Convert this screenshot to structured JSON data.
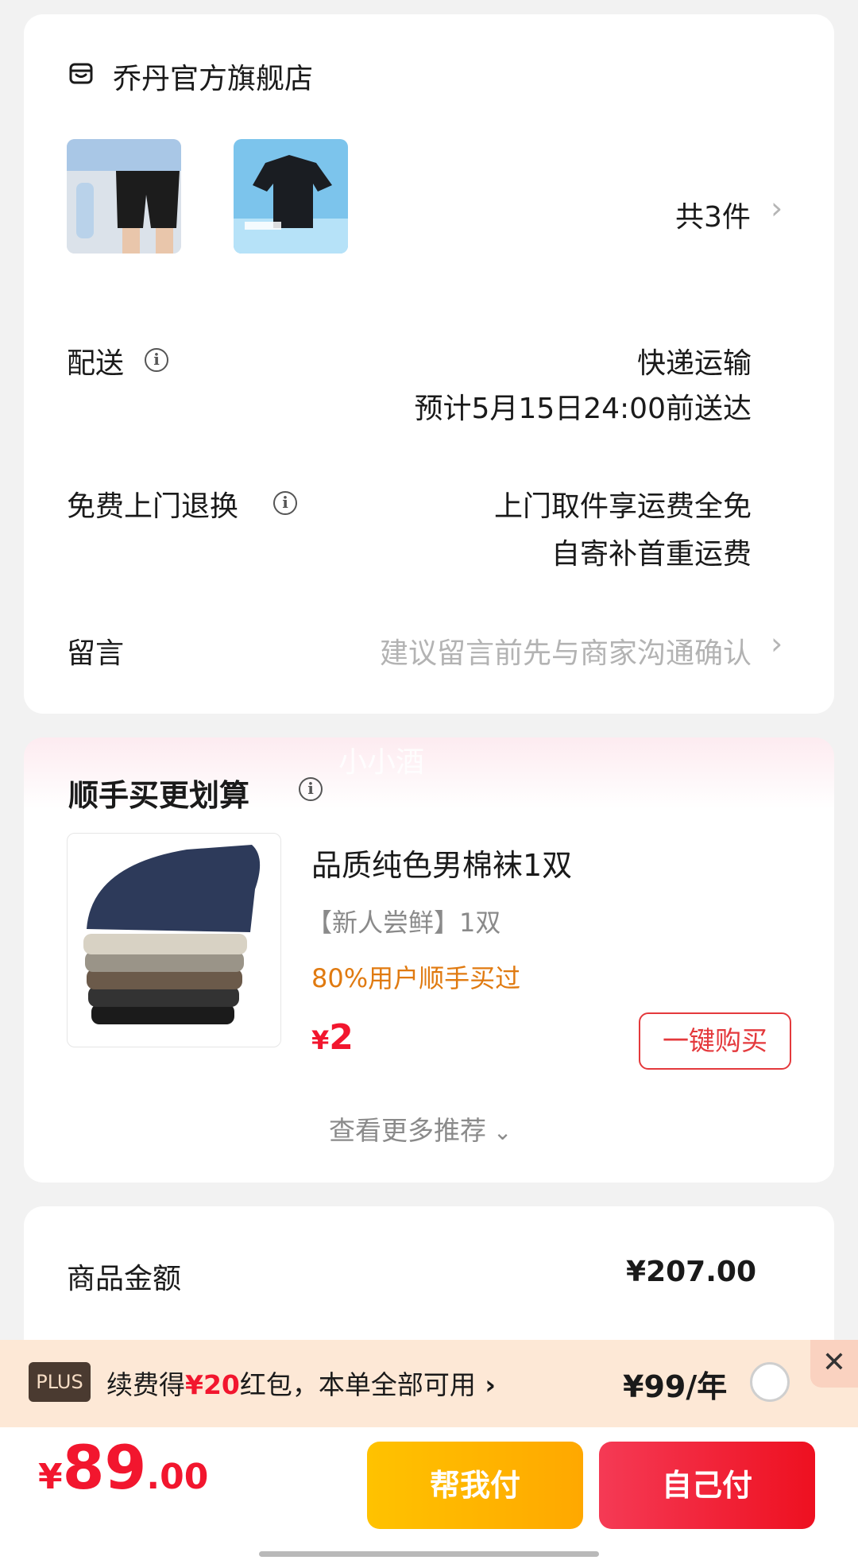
{
  "store": {
    "name": "乔丹官方旗舰店",
    "item_count": "共3件"
  },
  "delivery": {
    "label": "配送",
    "method": "快递运输",
    "eta": "预计5月15日24:00前送达"
  },
  "returns": {
    "label": "免费上门退换",
    "line1": "上门取件享运费全免",
    "line2": "自寄补首重运费"
  },
  "message": {
    "label": "留言",
    "placeholder": "建议留言前先与商家沟通确认"
  },
  "watermark": "小小酒",
  "recommend": {
    "title": "顺手买更划算",
    "product": {
      "name": "品质纯色男棉袜1双",
      "spec": "【新人尝鲜】1双",
      "social_proof": "80%用户顺手买过",
      "currency": "¥",
      "price": "2",
      "buy_label": "一键购买"
    },
    "more_label": "查看更多推荐"
  },
  "summary": {
    "label": "商品金额",
    "value": "¥207.00"
  },
  "plus": {
    "badge": "PLUS",
    "text_prefix": "续费得",
    "text_amount": "¥20",
    "text_suffix": "红包，本单全部可用",
    "price": "¥99/年"
  },
  "footer": {
    "currency": "¥",
    "total_int": "89",
    "total_dec": ".00",
    "help_pay": "帮我付",
    "self_pay": "自己付"
  },
  "colors": {
    "accent_red": "#f2162e",
    "orange": "#e07a10",
    "yellow": "#ffba00",
    "plus_bg": "#fde8d6"
  }
}
